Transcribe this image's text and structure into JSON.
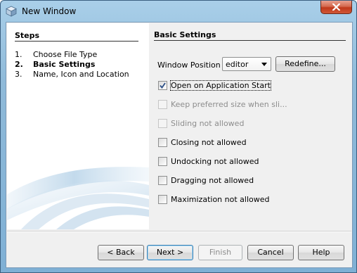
{
  "window": {
    "title": "New Window"
  },
  "steps": {
    "title": "Steps",
    "items": [
      {
        "num": "1.",
        "label": "Choose File Type"
      },
      {
        "num": "2.",
        "label": "Basic Settings"
      },
      {
        "num": "3.",
        "label": "Name, Icon and Location"
      }
    ],
    "current_index": 1
  },
  "settings": {
    "title": "Basic Settings",
    "window_position_label": "Window Position :",
    "window_position_value": "editor",
    "redefine_label": "Redefine...",
    "options": [
      {
        "label": "Open on Application Start",
        "checked": true,
        "enabled": true
      },
      {
        "label": "Keep preferred size when sli...",
        "checked": false,
        "enabled": false
      },
      {
        "label": "Sliding not allowed",
        "checked": false,
        "enabled": false
      },
      {
        "label": "Closing not allowed",
        "checked": false,
        "enabled": true
      },
      {
        "label": "Undocking not allowed",
        "checked": false,
        "enabled": true
      },
      {
        "label": "Dragging not allowed",
        "checked": false,
        "enabled": true
      },
      {
        "label": "Maximization not allowed",
        "checked": false,
        "enabled": true
      }
    ]
  },
  "footer": {
    "back_label": "< Back",
    "next_label": "Next >",
    "finish_label": "Finish",
    "cancel_label": "Cancel",
    "help_label": "Help"
  },
  "icons": {
    "app": "netbeans-cube-icon",
    "close": "close-icon",
    "combo": "chevron-down-icon",
    "check": "check-icon"
  }
}
